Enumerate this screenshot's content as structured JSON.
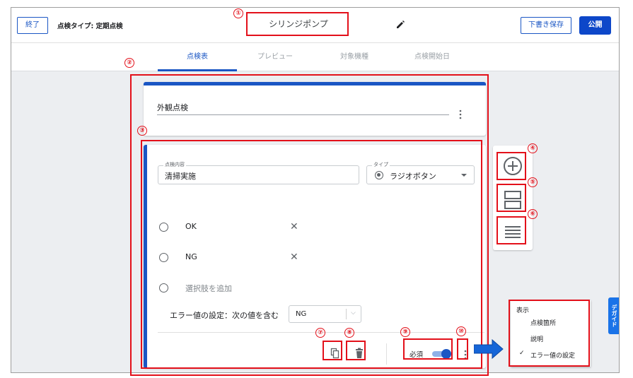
{
  "header": {
    "exit_label": "終了",
    "inspection_type": "点検タイプ: 定期点検",
    "title": "シリンジポンプ",
    "save_draft_label": "下書き保存",
    "publish_label": "公開"
  },
  "tabs": [
    {
      "label": "点検表",
      "active": true
    },
    {
      "label": "プレビュー",
      "active": false
    },
    {
      "label": "対象機種",
      "active": false
    },
    {
      "label": "点検開始日",
      "active": false
    }
  ],
  "section": {
    "title": "外観点検"
  },
  "item": {
    "field_label": "点検内容",
    "field_value": "清掃実施",
    "type_label": "タイプ",
    "type_value": "ラジオボタン",
    "options": [
      "OK",
      "NG"
    ],
    "add_option_label": "選択肢を追加",
    "error_setting_label": "エラー値の設定：次の値を含む",
    "error_value": "NG",
    "required_label": "必須",
    "required_on": true
  },
  "menu": {
    "header": "表示",
    "items": [
      {
        "label": "点検箇所",
        "checked": false
      },
      {
        "label": "説明",
        "checked": false
      },
      {
        "label": "エラー値の設定",
        "checked": true
      }
    ]
  },
  "guide_label": "デガイド",
  "callouts": [
    "①",
    "②",
    "③",
    "④",
    "⑤",
    "⑥",
    "⑦",
    "⑧",
    "⑨",
    "⑩"
  ],
  "colors": {
    "accent": "#1a56c4",
    "annotation": "#e3101a",
    "toggle": "#1a56c4"
  }
}
